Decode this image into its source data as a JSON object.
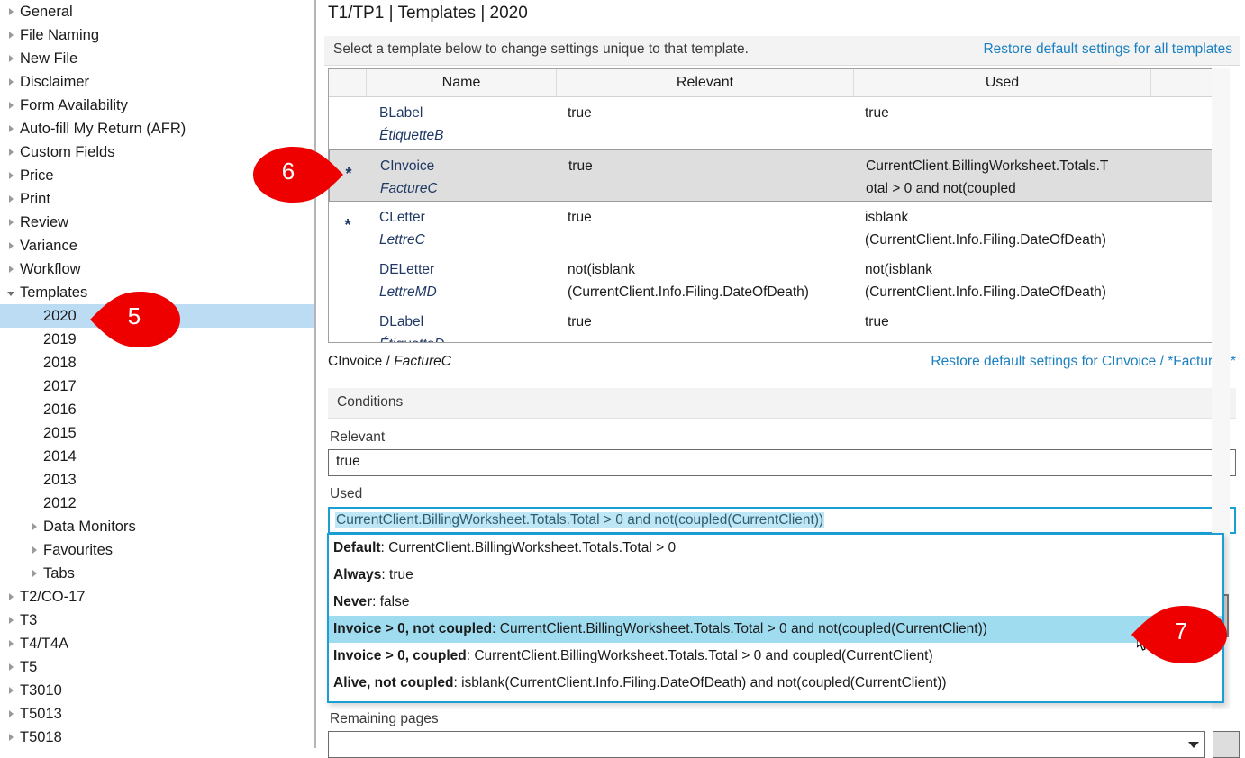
{
  "sidebar": {
    "items": [
      {
        "label": "General",
        "indent": 0,
        "arrow": "collapsed",
        "selected": false
      },
      {
        "label": "File Naming",
        "indent": 0,
        "arrow": "collapsed",
        "selected": false
      },
      {
        "label": "New File",
        "indent": 0,
        "arrow": "collapsed",
        "selected": false
      },
      {
        "label": "Disclaimer",
        "indent": 0,
        "arrow": "collapsed",
        "selected": false
      },
      {
        "label": "Form Availability",
        "indent": 0,
        "arrow": "collapsed",
        "selected": false
      },
      {
        "label": "Auto-fill My Return (AFR)",
        "indent": 0,
        "arrow": "collapsed",
        "selected": false
      },
      {
        "label": "Custom Fields",
        "indent": 0,
        "arrow": "collapsed",
        "selected": false
      },
      {
        "label": "Price",
        "indent": 0,
        "arrow": "collapsed",
        "selected": false
      },
      {
        "label": "Print",
        "indent": 0,
        "arrow": "collapsed",
        "selected": false
      },
      {
        "label": "Review",
        "indent": 0,
        "arrow": "collapsed",
        "selected": false
      },
      {
        "label": "Variance",
        "indent": 0,
        "arrow": "collapsed",
        "selected": false
      },
      {
        "label": "Workflow",
        "indent": 0,
        "arrow": "collapsed",
        "selected": false
      },
      {
        "label": "Templates",
        "indent": 0,
        "arrow": "expanded",
        "selected": false
      },
      {
        "label": "2020",
        "indent": 1,
        "arrow": "none",
        "selected": true
      },
      {
        "label": "2019",
        "indent": 1,
        "arrow": "none",
        "selected": false
      },
      {
        "label": "2018",
        "indent": 1,
        "arrow": "none",
        "selected": false
      },
      {
        "label": "2017",
        "indent": 1,
        "arrow": "none",
        "selected": false
      },
      {
        "label": "2016",
        "indent": 1,
        "arrow": "none",
        "selected": false
      },
      {
        "label": "2015",
        "indent": 1,
        "arrow": "none",
        "selected": false
      },
      {
        "label": "2014",
        "indent": 1,
        "arrow": "none",
        "selected": false
      },
      {
        "label": "2013",
        "indent": 1,
        "arrow": "none",
        "selected": false
      },
      {
        "label": "2012",
        "indent": 1,
        "arrow": "none",
        "selected": false
      },
      {
        "label": "Data Monitors",
        "indent": 1,
        "arrow": "collapsed",
        "selected": false
      },
      {
        "label": "Favourites",
        "indent": 1,
        "arrow": "collapsed",
        "selected": false
      },
      {
        "label": "Tabs",
        "indent": 1,
        "arrow": "collapsed",
        "selected": false
      },
      {
        "label": "T2/CO-17",
        "indent": 0,
        "arrow": "collapsed",
        "selected": false
      },
      {
        "label": "T3",
        "indent": 0,
        "arrow": "collapsed",
        "selected": false
      },
      {
        "label": "T4/T4A",
        "indent": 0,
        "arrow": "collapsed",
        "selected": false
      },
      {
        "label": "T5",
        "indent": 0,
        "arrow": "collapsed",
        "selected": false
      },
      {
        "label": "T3010",
        "indent": 0,
        "arrow": "collapsed",
        "selected": false
      },
      {
        "label": "T5013",
        "indent": 0,
        "arrow": "collapsed",
        "selected": false
      },
      {
        "label": "T5018",
        "indent": 0,
        "arrow": "collapsed",
        "selected": false
      }
    ]
  },
  "main": {
    "page_title": "T1/TP1 | Templates | 2020",
    "instruction": "Select a template below to change settings unique to that template.",
    "restore_all_link": "Restore default settings for all templates",
    "table": {
      "columns": [
        "",
        "Name",
        "Relevant",
        "Used",
        ""
      ],
      "rows": [
        {
          "marker": "",
          "name_en": "BLabel",
          "name_fr": "ÉtiquetteB",
          "relevant_l1": "true",
          "relevant_l2": "",
          "used_l1": "true",
          "used_l2": "",
          "selected": false
        },
        {
          "marker": "*",
          "name_en": "CInvoice",
          "name_fr": "FactureC",
          "relevant_l1": "true",
          "relevant_l2": "",
          "used_l1": "CurrentClient.BillingWorksheet.Totals.T",
          "used_l2": "otal > 0 and not(coupled",
          "selected": true
        },
        {
          "marker": "*",
          "name_en": "CLetter",
          "name_fr": "LettreC",
          "relevant_l1": "true",
          "relevant_l2": "",
          "used_l1": "isblank",
          "used_l2": "(CurrentClient.Info.Filing.DateOfDeath)",
          "selected": false
        },
        {
          "marker": "",
          "name_en": "DELetter",
          "name_fr": "LettreMD",
          "relevant_l1": "not(isblank",
          "relevant_l2": "(CurrentClient.Info.Filing.DateOfDeath)",
          "used_l1": "not(isblank",
          "used_l2": "(CurrentClient.Info.Filing.DateOfDeath)",
          "selected": false
        },
        {
          "marker": "",
          "name_en": "DLabel",
          "name_fr": "ÉtiquetteD",
          "relevant_l1": "true",
          "relevant_l2": "",
          "used_l1": "true",
          "used_l2": "",
          "selected": false
        }
      ]
    },
    "sub_header": {
      "name_en": "CInvoice",
      "separator": " / ",
      "name_fr": "FactureC",
      "restore_link": "Restore default settings for CInvoice / *FactureC*"
    },
    "conditions": {
      "section_label": "Conditions",
      "relevant": {
        "label": "Relevant",
        "value": "true"
      },
      "used": {
        "label": "Used",
        "value": "CurrentClient.BillingWorksheet.Totals.Total > 0 and not(coupled(CurrentClient))"
      },
      "remaining_pages": {
        "label": "Remaining pages",
        "value": ""
      }
    },
    "dropdown": {
      "options": [
        {
          "name": "Default",
          "expr": ": CurrentClient.BillingWorksheet.Totals.Total > 0",
          "highlighted": false
        },
        {
          "name": "Always",
          "expr": ": true",
          "highlighted": false
        },
        {
          "name": "Never",
          "expr": ": false",
          "highlighted": false
        },
        {
          "name": "Invoice > 0, not coupled",
          "expr": ": CurrentClient.BillingWorksheet.Totals.Total > 0 and not(coupled(CurrentClient))",
          "highlighted": true
        },
        {
          "name": "Invoice > 0, coupled",
          "expr": ": CurrentClient.BillingWorksheet.Totals.Total > 0 and coupled(CurrentClient)",
          "highlighted": false
        },
        {
          "name": "Alive, not coupled",
          "expr": ": isblank(CurrentClient.Info.Filing.DateOfDeath) and not(coupled(CurrentClient))",
          "highlighted": false
        }
      ]
    }
  },
  "callouts": [
    {
      "id": "5",
      "number": "5",
      "direction": "left"
    },
    {
      "id": "6",
      "number": "6",
      "direction": "right"
    },
    {
      "id": "7",
      "number": "7",
      "direction": "left"
    }
  ],
  "colors": {
    "accent_link": "#1a7fc1",
    "callout_red": "#ee0000",
    "selection_blue": "#bcdcf4",
    "highlight_cyan": "#9fdcf0",
    "focus_border": "#1a9fd4",
    "table_row_selected": "#dedede",
    "name_text": "#1f3864"
  }
}
